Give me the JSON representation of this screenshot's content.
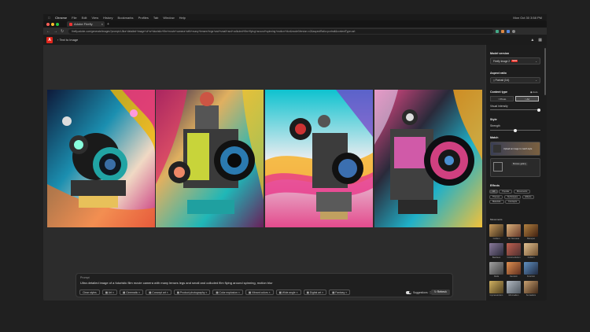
{
  "menubar": {
    "items": [
      "Chrome",
      "File",
      "Edit",
      "View",
      "History",
      "Bookmarks",
      "Profiles",
      "Tab",
      "Window",
      "Help"
    ],
    "clock": "Mon Oct 30 3:58 PM"
  },
  "browser": {
    "tab_title": "Adobe Firefly",
    "url": "firefly.adobe.com/generate/images?prompt=Ultra+detailed+image+of+a+futuristic+film+movie+camera+with+many+lenses+legs+and+small+and+colluded+film+flying+around+spinning+motion+blur&modelVersion=v2&aspectRatio=portrait&contentType=art"
  },
  "app": {
    "breadcrumb": "Text to image"
  },
  "prompt": {
    "label": "Prompt",
    "text": "Ultra detailed image of a futuristic film movie camera with many lenses legs and small and colluded film flying around spinning, motion blur",
    "chips": [
      "Clear styles",
      "Art",
      "Cinematic",
      "Concept art",
      "Product photography",
      "Color explosion",
      "Vibrant colors",
      "Wide angle",
      "Digital art",
      "Fantasy"
    ],
    "suggestions_label": "Suggestions",
    "refresh_label": "Refresh"
  },
  "panel": {
    "model_version_title": "Model version",
    "model_version_value": "Firefly Image 2",
    "model_badge": "NEW",
    "aspect_ratio_title": "Aspect ratio",
    "aspect_ratio_value": "Portrait (3:4)",
    "content_type_title": "Content type",
    "content_type_auto": "Auto",
    "content_type_photo": "Photo",
    "content_type_art": "Art",
    "visual_intensity": "Visual intensity",
    "style_title": "Style",
    "strength_label": "Strength",
    "match_title": "Match",
    "match_caption": "Upload an image to match style",
    "gallery_button": "Browse gallery",
    "effects_title": "Effects",
    "effects_tabs": [
      "All",
      "Popular",
      "Movements",
      "Themes",
      "Techniques",
      "Effects",
      "Materials",
      "Concepts"
    ],
    "movements_title": "Movements",
    "thumbs": [
      "Cubism",
      "Art Nouveau",
      "Baroque",
      "Bauhaus",
      "Constructivism",
      "Cubism",
      "Dada",
      "Fauvism",
      "Futurism",
      "Impressionism",
      "Minimalism",
      "Surrealism"
    ]
  },
  "colors": {
    "accent": "#e1251b",
    "panel": "#1d1d1d",
    "canvas": "#2c2c2c"
  }
}
